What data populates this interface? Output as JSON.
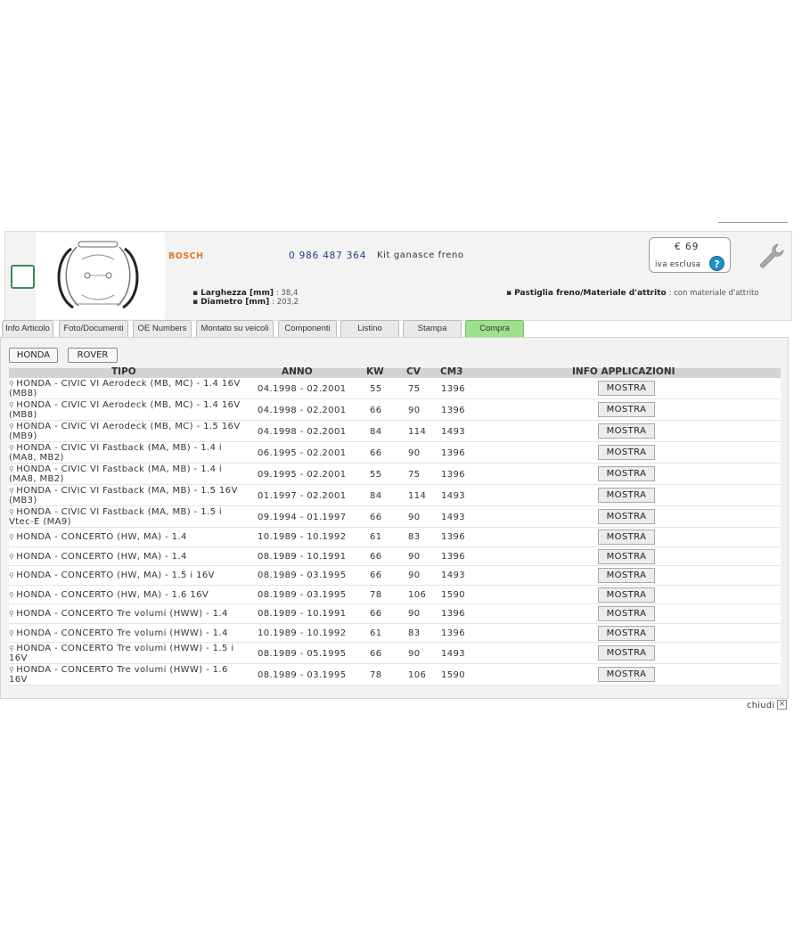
{
  "product": {
    "brand": "BOSCH",
    "code": "0 986 487 364",
    "description": "Kit ganasce freno",
    "price": "€ 69",
    "price_note": "iva esclusa",
    "specs_left": [
      {
        "label": "Larghezza [mm]",
        "value": ": 38,4"
      },
      {
        "label": "Diametro [mm]",
        "value": ": 203,2"
      }
    ],
    "specs_right": [
      {
        "label": "Pastiglia freno/Materiale d'attrito",
        "value": ": con materiale d'attrito"
      }
    ]
  },
  "tabs": [
    "Info Articolo",
    "Foto/Documenti",
    "OE Numbers",
    "Montato su veicoli",
    "Componenti",
    "Listino",
    "Stampa",
    "Compra"
  ],
  "active_tab": "Compra",
  "brand_filters": [
    "HONDA",
    "ROVER"
  ],
  "table": {
    "headers": {
      "tipo": "TIPO",
      "anno": "ANNO",
      "kw": "KW",
      "cv": "CV",
      "cm3": "CM3",
      "info": "INFO APPLICAZIONI"
    },
    "button_label": "MOSTRA",
    "rows": [
      {
        "tipo": "HONDA - CIVIC VI Aerodeck (MB, MC) - 1.4 16V (MB8)",
        "anno": "04.1998 - 02.2001",
        "kw": "55",
        "cv": "75",
        "cm3": "1396"
      },
      {
        "tipo": "HONDA - CIVIC VI Aerodeck (MB, MC) - 1.4 16V (MB8)",
        "anno": "04.1998 - 02.2001",
        "kw": "66",
        "cv": "90",
        "cm3": "1396"
      },
      {
        "tipo": "HONDA - CIVIC VI Aerodeck (MB, MC) - 1.5 16V (MB9)",
        "anno": "04.1998 - 02.2001",
        "kw": "84",
        "cv": "114",
        "cm3": "1493"
      },
      {
        "tipo": "HONDA - CIVIC VI Fastback (MA, MB) - 1.4 i (MA8, MB2)",
        "anno": "06.1995 - 02.2001",
        "kw": "66",
        "cv": "90",
        "cm3": "1396"
      },
      {
        "tipo": "HONDA - CIVIC VI Fastback (MA, MB) - 1.4 i (MA8, MB2)",
        "anno": "09.1995 - 02.2001",
        "kw": "55",
        "cv": "75",
        "cm3": "1396"
      },
      {
        "tipo": "HONDA - CIVIC VI Fastback (MA, MB) - 1.5 16V (MB3)",
        "anno": "01.1997 - 02.2001",
        "kw": "84",
        "cv": "114",
        "cm3": "1493"
      },
      {
        "tipo": "HONDA - CIVIC VI Fastback (MA, MB) - 1.5 i Vtec-E (MA9)",
        "anno": "09.1994 - 01.1997",
        "kw": "66",
        "cv": "90",
        "cm3": "1493"
      },
      {
        "tipo": "HONDA - CONCERTO (HW, MA) - 1.4",
        "anno": "10.1989 - 10.1992",
        "kw": "61",
        "cv": "83",
        "cm3": "1396"
      },
      {
        "tipo": "HONDA - CONCERTO (HW, MA) - 1.4",
        "anno": "08.1989 - 10.1991",
        "kw": "66",
        "cv": "90",
        "cm3": "1396"
      },
      {
        "tipo": "HONDA - CONCERTO (HW, MA) - 1.5 i 16V",
        "anno": "08.1989 - 03.1995",
        "kw": "66",
        "cv": "90",
        "cm3": "1493"
      },
      {
        "tipo": "HONDA - CONCERTO (HW, MA) - 1.6 16V",
        "anno": "08.1989 - 03.1995",
        "kw": "78",
        "cv": "106",
        "cm3": "1590"
      },
      {
        "tipo": "HONDA - CONCERTO Tre volumi (HWW) - 1.4",
        "anno": "08.1989 - 10.1991",
        "kw": "66",
        "cv": "90",
        "cm3": "1396"
      },
      {
        "tipo": "HONDA - CONCERTO Tre volumi (HWW) - 1.4",
        "anno": "10.1989 - 10.1992",
        "kw": "61",
        "cv": "83",
        "cm3": "1396"
      },
      {
        "tipo": "HONDA - CONCERTO Tre volumi (HWW) - 1.5 i 16V",
        "anno": "08.1989 - 05.1995",
        "kw": "66",
        "cv": "90",
        "cm3": "1493"
      },
      {
        "tipo": "HONDA - CONCERTO Tre volumi (HWW) - 1.6 16V",
        "anno": "08.1989 - 03.1995",
        "kw": "78",
        "cv": "106",
        "cm3": "1590"
      }
    ]
  },
  "footer": {
    "close_label": "chiudi",
    "close_icon": "close-icon"
  }
}
